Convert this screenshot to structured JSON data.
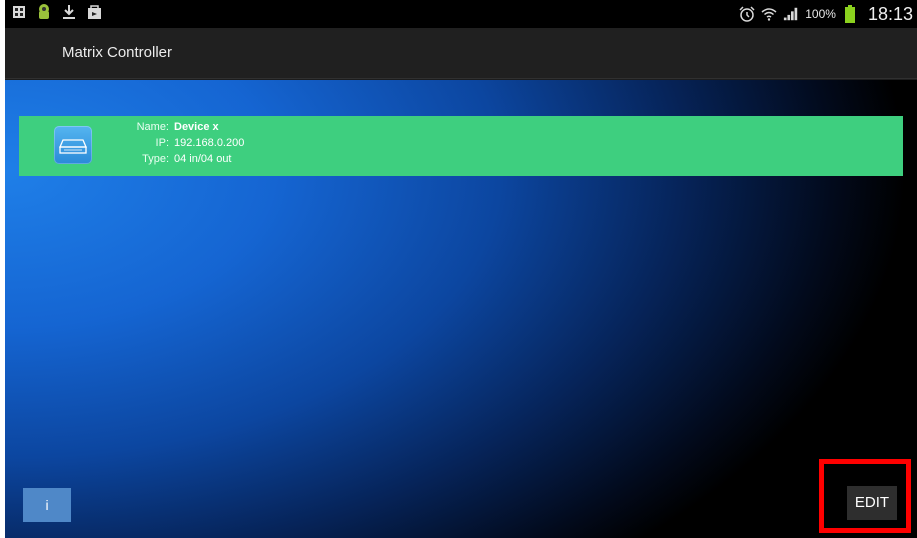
{
  "status_bar": {
    "left_icons": [
      "gallery-icon",
      "android-icon",
      "download-icon",
      "shopping-bag-icon"
    ],
    "right_icons": [
      "alarm-icon",
      "wifi-icon",
      "signal-icon",
      "battery-icon"
    ],
    "battery_percent": "100%",
    "time": "18:13"
  },
  "action_bar": {
    "title": "Matrix Controller"
  },
  "devices": [
    {
      "name_label": "Name:",
      "name": "Device x",
      "ip_label": "IP:",
      "ip": "192.168.0.200",
      "type_label": "Type:",
      "type": "04 in/04 out",
      "icon": "device-icon"
    }
  ],
  "buttons": {
    "info_label": "i",
    "edit_label": "EDIT"
  },
  "colors": {
    "device_row": "#3ecf7f",
    "highlight": "#ff0000",
    "info_button": "#4f88c8",
    "edit_button": "#2e2e2e"
  }
}
